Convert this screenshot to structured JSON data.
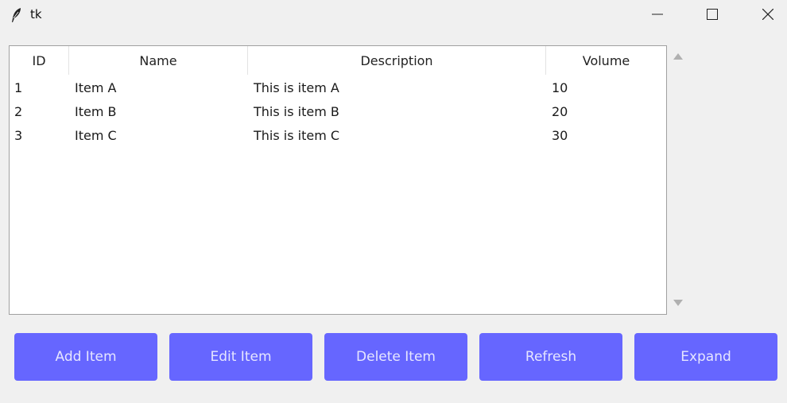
{
  "window": {
    "title": "tk"
  },
  "table": {
    "columns": [
      "ID",
      "Name",
      "Description",
      "Volume"
    ],
    "rows": [
      {
        "id": "1",
        "name": "Item A",
        "description": "This is item A",
        "volume": "10"
      },
      {
        "id": "2",
        "name": "Item B",
        "description": "This is item B",
        "volume": "20"
      },
      {
        "id": "3",
        "name": "Item C",
        "description": "This is item C",
        "volume": "30"
      }
    ]
  },
  "buttons": {
    "add": "Add Item",
    "edit": "Edit Item",
    "delete": "Delete Item",
    "refresh": "Refresh",
    "expand": "Expand"
  },
  "colors": {
    "button_bg": "#6666ff",
    "button_text": "#e6e6ff",
    "window_bg": "#f0f0f0"
  },
  "icons": {
    "app": "feather-icon",
    "minimize": "minimize-icon",
    "maximize": "maximize-icon",
    "close": "close-icon",
    "scroll_up": "scroll-up-arrow-icon",
    "scroll_down": "scroll-down-arrow-icon"
  }
}
